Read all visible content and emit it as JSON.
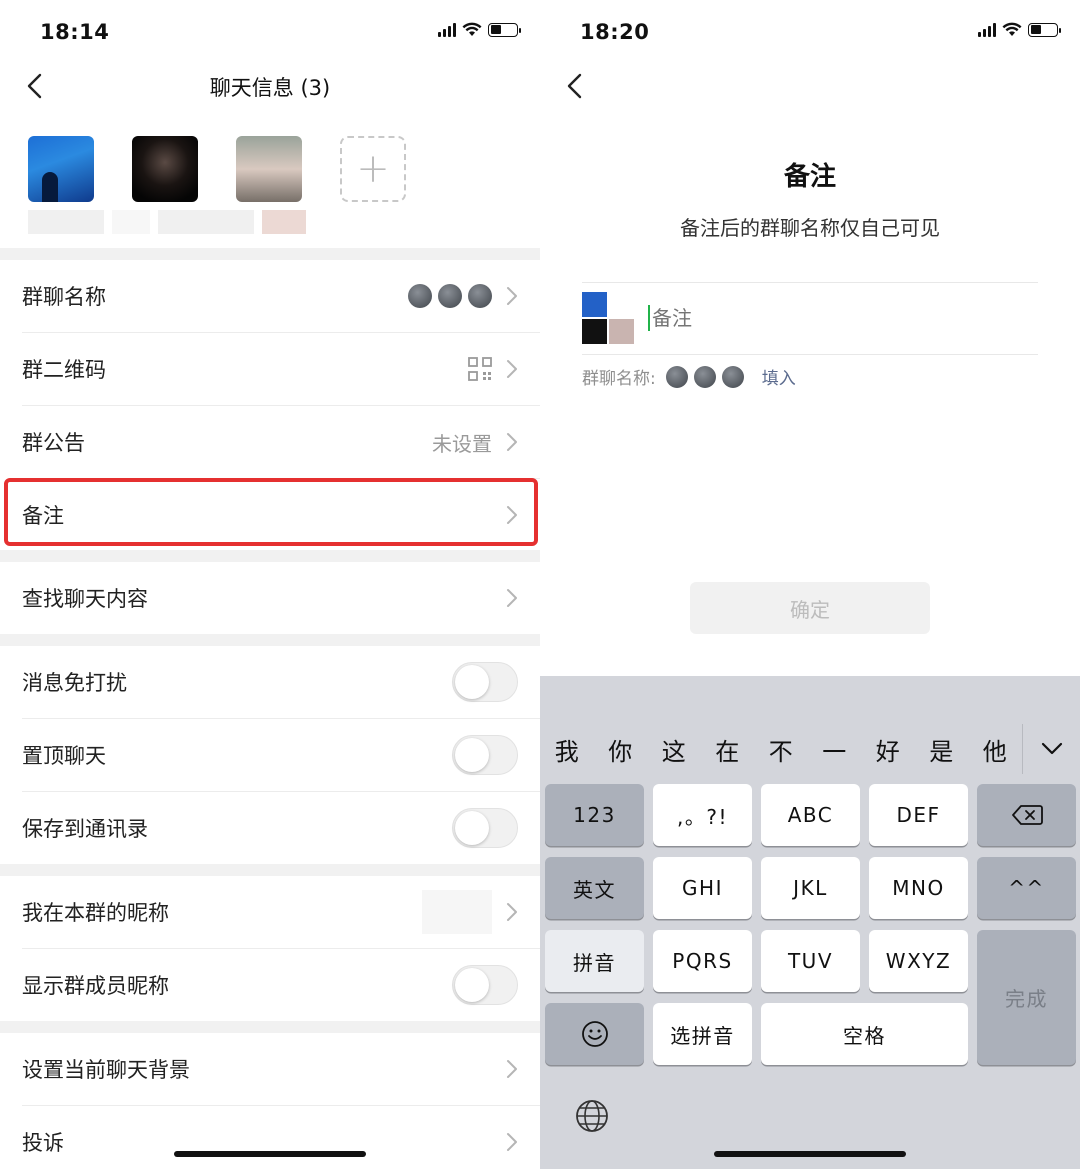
{
  "left": {
    "status_time": "18:14",
    "title": "聊天信息 (3)",
    "add_member_symbol": "+",
    "rows": {
      "group_name": {
        "label": "群聊名称"
      },
      "qr_code": {
        "label": "群二维码"
      },
      "announcement": {
        "label": "群公告",
        "value": "未设置"
      },
      "remark": {
        "label": "备注"
      },
      "search": {
        "label": "查找聊天内容"
      },
      "mute": {
        "label": "消息免打扰",
        "on": false
      },
      "pin": {
        "label": "置顶聊天",
        "on": false
      },
      "save_contacts": {
        "label": "保存到通讯录",
        "on": false
      },
      "my_nickname": {
        "label": "我在本群的昵称"
      },
      "show_nicknames": {
        "label": "显示群成员昵称",
        "on": false
      },
      "background": {
        "label": "设置当前聊天背景"
      },
      "report": {
        "label": "投诉"
      }
    },
    "highlight_color": "#e53030"
  },
  "right": {
    "status_time": "18:20",
    "title": "备注",
    "subtitle": "备注后的群聊名称仅自己可见",
    "input_placeholder": "备注",
    "group_name_label": "群聊名称:",
    "fill_label": "填入",
    "confirm_label": "确定",
    "keyboard": {
      "candidates": [
        "我",
        "你",
        "这",
        "在",
        "不",
        "一",
        "好",
        "是",
        "他"
      ],
      "keys": {
        "num": "123",
        "punct": ",。?!",
        "abc": "ABC",
        "def": "DEF",
        "eng": "英文",
        "ghi": "GHI",
        "jkl": "JKL",
        "mno": "MNO",
        "face": "^^",
        "pinyin": "拼音",
        "pqrs": "PQRS",
        "tuv": "TUV",
        "wxyz": "WXYZ",
        "done": "完成",
        "select_pinyin": "选拼音",
        "space": "空格"
      }
    }
  },
  "colors": {
    "caret": "#21b34a",
    "keyboard_bg": "#d3d5db"
  }
}
